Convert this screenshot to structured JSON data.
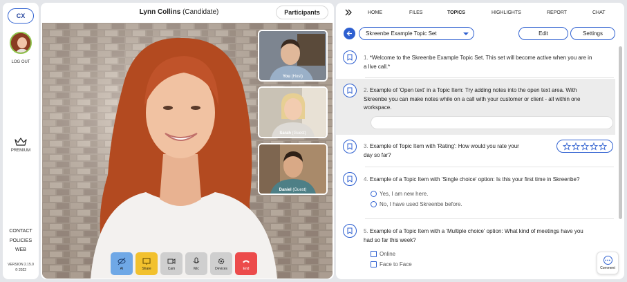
{
  "nav": {
    "cx": "CX",
    "logout": "LOG OUT",
    "premium": "PREMIUM",
    "links": [
      "CONTACT",
      "POLICIES",
      "WEB"
    ],
    "version": "VERSION 2.15.0",
    "year": "© 2022"
  },
  "video": {
    "candidate_name": "Lynn Collins",
    "candidate_role": "(Candidate)",
    "participants_label": "Participants",
    "thumbs": [
      {
        "name": "You",
        "role": "(Host)"
      },
      {
        "name": "Sarah",
        "role": "(Guest)"
      },
      {
        "name": "Daniel",
        "role": "(Guest)"
      }
    ],
    "controls": [
      {
        "label": "AI",
        "icon": "eye-off-icon",
        "color": "#6fa8e6"
      },
      {
        "label": "Share",
        "icon": "monitor-icon",
        "color": "#f2c12e"
      },
      {
        "label": "Cam",
        "icon": "camera-icon",
        "color": "#cfcfcf"
      },
      {
        "label": "Mic",
        "icon": "mic-icon",
        "color": "#cfcfcf"
      },
      {
        "label": "Devices",
        "icon": "gear-icon",
        "color": "#cfcfcf"
      },
      {
        "label": "End",
        "icon": "phone-hangup-icon",
        "color": "#ec4b4b"
      }
    ]
  },
  "panel": {
    "tabs": [
      "HOME",
      "FILES",
      "TOPICS",
      "HIGHLIGHTS",
      "REPORT",
      "CHAT"
    ],
    "active_tab": "TOPICS",
    "topic_set": "Skreenbe Example Topic Set",
    "edit_label": "Edit",
    "settings_label": "Settings",
    "topics": [
      {
        "num": "1.",
        "text_l1": "*Welcome to the Skreenbe Example Topic Set. This set will become active when you are in",
        "text_l2": "a live call.*"
      },
      {
        "num": "2.",
        "text_l1": "Example of 'Open text' in a Topic Item: Try adding notes into the open text area. With",
        "text_l2": "Skreenbe you can make notes while on a call with your customer or client - all within one",
        "text_l3": "workspace."
      },
      {
        "num": "3.",
        "text_l1": "Example of Topic Item with 'Rating': How would you rate your",
        "text_l2": "day so far?"
      },
      {
        "num": "4.",
        "text_l1": "Example of a Topic Item with 'Single choice' option: Is this your first time in Skreenbe?"
      },
      {
        "num": "5.",
        "text_l1": "Example of a Topic Item with a 'Multiple choice' option: What kind of meetings have you",
        "text_l2": "had so far this week?"
      }
    ],
    "single_options": [
      "Yes, I am new here.",
      "No, I have used Skreenbe before."
    ],
    "multi_options": [
      "Online",
      "Face to Face"
    ],
    "comment_label": "Comment"
  },
  "colors": {
    "accent": "#2d5fd0",
    "background": "#e4e6ea"
  }
}
